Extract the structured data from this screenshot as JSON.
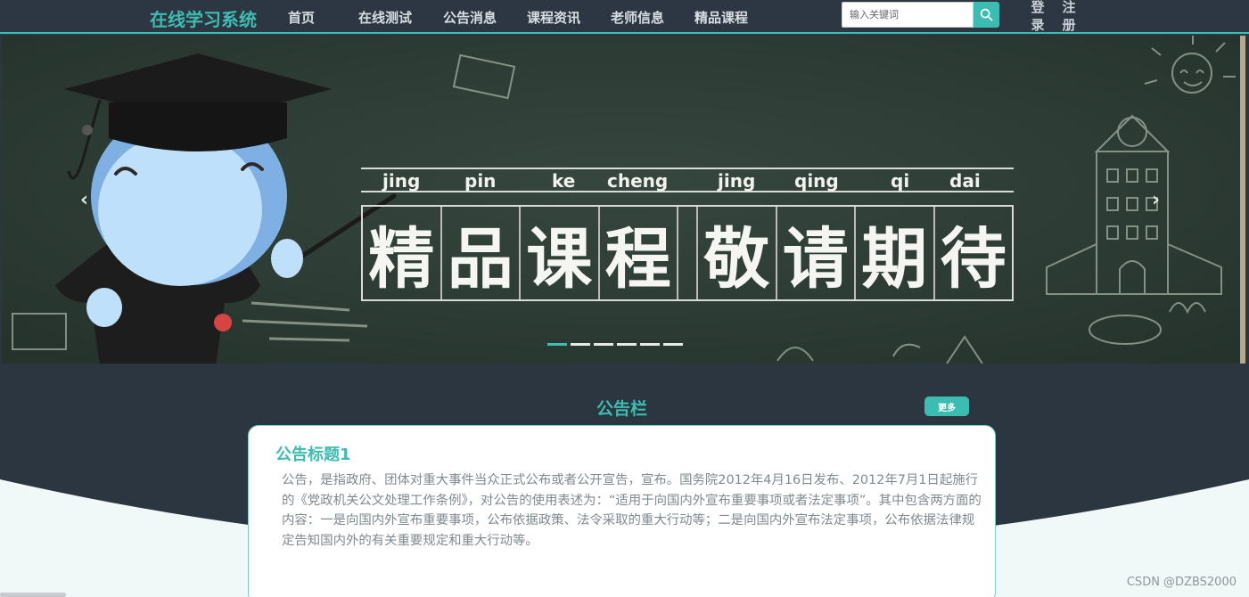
{
  "header": {
    "brand": "在线学习系统",
    "nav": [
      {
        "label": "首页",
        "name": "nav-home"
      },
      {
        "label": "在线测试",
        "name": "nav-online-test"
      },
      {
        "label": "公告消息",
        "name": "nav-notice"
      },
      {
        "label": "课程资讯",
        "name": "nav-course-news"
      },
      {
        "label": "老师信息",
        "name": "nav-teacher-info"
      },
      {
        "label": "精品课程",
        "name": "nav-featured-courses"
      }
    ],
    "search": {
      "placeholder": "输入关键词",
      "value": ""
    },
    "auth": {
      "login": "登录",
      "login_chars": [
        "登",
        "录"
      ],
      "register": "注册",
      "register_chars": [
        "注",
        "册"
      ]
    }
  },
  "banner": {
    "pinyin": [
      "jing",
      "pin",
      "ke",
      "cheng",
      "jing",
      "qing",
      "qi",
      "dai"
    ],
    "title_chars": [
      "精",
      "品",
      "课",
      "程",
      "敬",
      "请",
      "期",
      "待"
    ],
    "slides_count": 6,
    "active_slide": 0
  },
  "notice": {
    "section_title": "公告栏",
    "more_label": "更多",
    "card": {
      "title": "公告标题1",
      "body": "公告，是指政府、团体对重大事件当众正式公布或者公开宣告，宣布。国务院2012年4月16日发布、2012年7月1日起施行的《党政机关公文处理工作条例》，对公告的使用表述为：“适用于向国内外宣布重要事项或者法定事项”。其中包含两方面的内容：一是向国内外宣布重要事项，公布依据政策、法令采取的重大行动等；二是向国内外宣布法定事项，公布依据法律规定告知国内外的有关重要规定和重大行动等。"
    }
  },
  "watermark": "CSDN @DZBS2000",
  "colors": {
    "accent": "#3cbdb1",
    "header_bg": "#2d3743",
    "page_bg": "#2b3641",
    "wave": "#f1f8f8"
  }
}
